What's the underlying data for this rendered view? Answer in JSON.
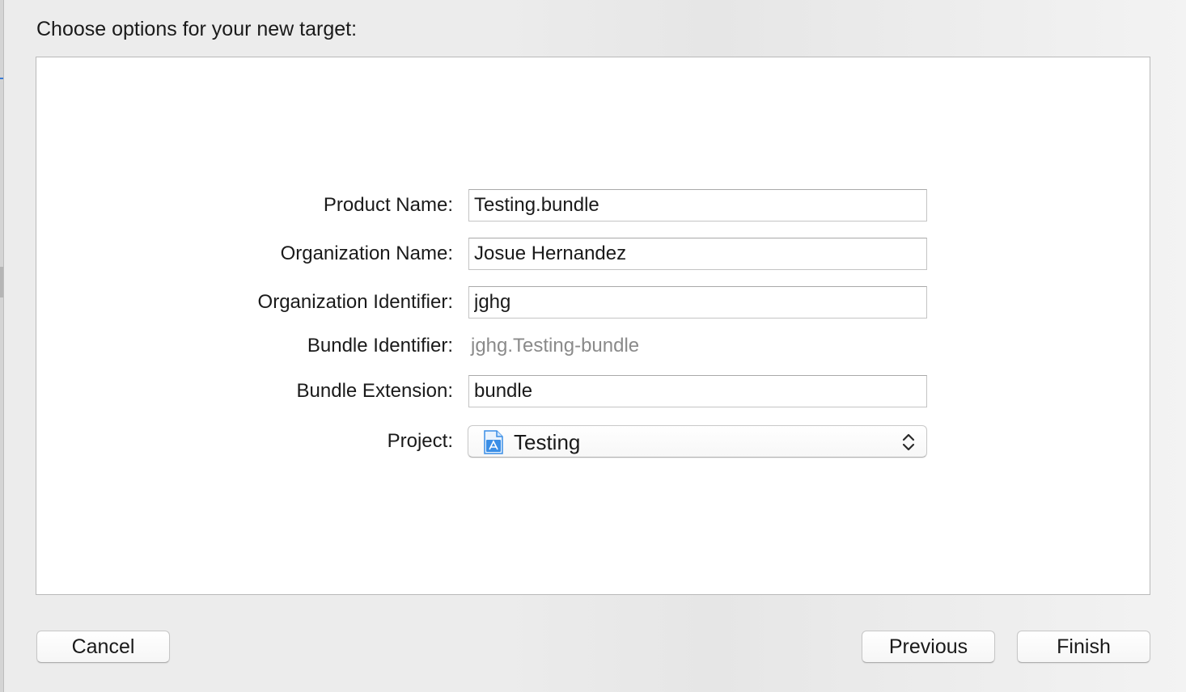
{
  "dialog": {
    "title": "Choose options for your new target:"
  },
  "form": {
    "product_name": {
      "label": "Product Name:",
      "value": "Testing.bundle"
    },
    "organization_name": {
      "label": "Organization Name:",
      "value": "Josue Hernandez"
    },
    "organization_identifier": {
      "label": "Organization Identifier:",
      "value": "jghg"
    },
    "bundle_identifier": {
      "label": "Bundle Identifier:",
      "value": "jghg.Testing-bundle"
    },
    "bundle_extension": {
      "label": "Bundle Extension:",
      "value": "bundle"
    },
    "project": {
      "label": "Project:",
      "selected": "Testing",
      "icon": "xcode-project-icon"
    }
  },
  "buttons": {
    "cancel": "Cancel",
    "previous": "Previous",
    "finish": "Finish"
  },
  "colors": {
    "window_bg": "#ececec",
    "panel_bg": "#ffffff",
    "muted_text": "#8a8a8a",
    "icon_blue": "#3a8ee6"
  }
}
